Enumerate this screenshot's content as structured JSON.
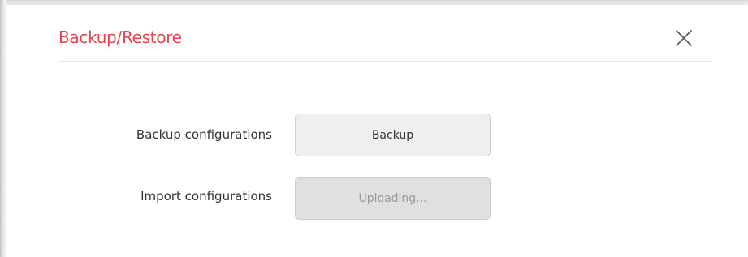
{
  "dialog": {
    "title": "Backup/Restore",
    "title_color": "#e8434e",
    "close_icon": "close-icon"
  },
  "form": {
    "backup": {
      "label": "Backup configurations",
      "button_label": "Backup"
    },
    "import": {
      "label": "Import configurations",
      "button_label": "Uploading...",
      "button_state": "disabled"
    }
  }
}
